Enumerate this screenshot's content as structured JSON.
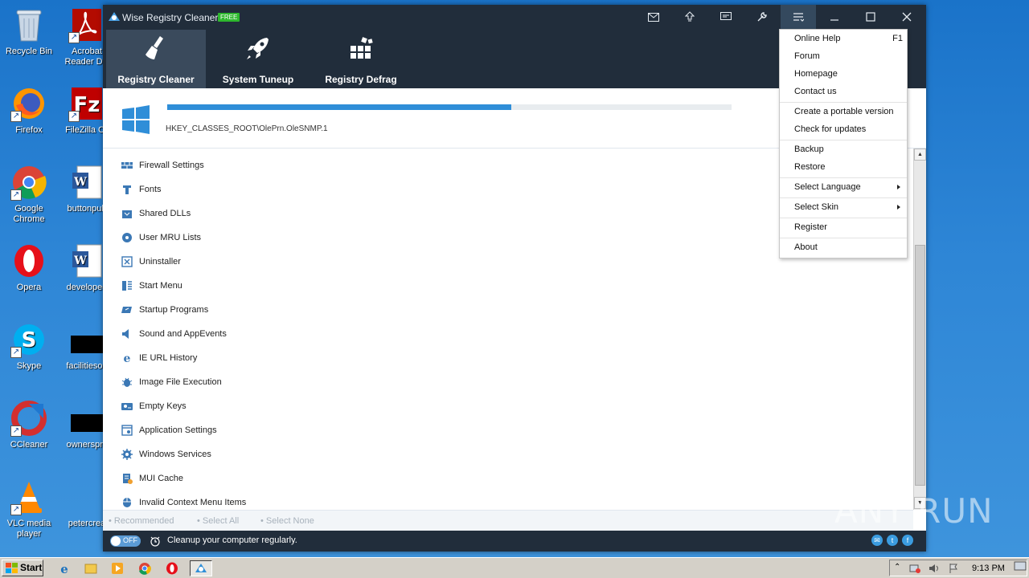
{
  "desktop": {
    "icons": [
      {
        "label": "Recycle Bin"
      },
      {
        "label": "Acrobat Reader DC"
      },
      {
        "label": "Firefox"
      },
      {
        "label": "FileZilla Cli"
      },
      {
        "label": "Google Chrome"
      },
      {
        "label": "buttonpub"
      },
      {
        "label": "Opera"
      },
      {
        "label": "developed"
      },
      {
        "label": "Skype"
      },
      {
        "label": "facilitiesop"
      },
      {
        "label": "CCleaner"
      },
      {
        "label": "ownerspm"
      },
      {
        "label": "VLC media player"
      },
      {
        "label": "petercrea"
      }
    ]
  },
  "window": {
    "title": "Wise Registry Cleaner X",
    "badge": "FREE",
    "titlebar_icons": [
      "mail-icon",
      "upgrade-icon",
      "feedback-icon",
      "tools-icon",
      "menu-icon",
      "minimize-icon",
      "maximize-icon",
      "close-icon"
    ]
  },
  "nav": {
    "tabs": [
      {
        "label": "Registry Cleaner",
        "active": true
      },
      {
        "label": "System Tuneup",
        "active": false
      },
      {
        "label": "Registry Defrag",
        "active": false
      }
    ]
  },
  "scan": {
    "progress": 0.61,
    "current_key": "HKEY_CLASSES_ROOT\\OlePrn.OleSNMP.1"
  },
  "categories": [
    {
      "label": "Firewall Settings",
      "icon": "firewall-icon"
    },
    {
      "label": "Fonts",
      "icon": "font-icon"
    },
    {
      "label": "Shared DLLs",
      "icon": "dll-icon"
    },
    {
      "label": "User MRU Lists",
      "icon": "mru-icon"
    },
    {
      "label": "Uninstaller",
      "icon": "uninstaller-icon"
    },
    {
      "label": "Start Menu",
      "icon": "start-menu-icon"
    },
    {
      "label": "Startup Programs",
      "icon": "startup-icon"
    },
    {
      "label": "Sound and AppEvents",
      "icon": "sound-icon"
    },
    {
      "label": "IE URL History",
      "icon": "ie-icon"
    },
    {
      "label": "Image File Execution",
      "icon": "bug-icon"
    },
    {
      "label": "Empty Keys",
      "icon": "key-icon"
    },
    {
      "label": "Application Settings",
      "icon": "app-settings-icon"
    },
    {
      "label": "Windows Services",
      "icon": "gear-icon"
    },
    {
      "label": "MUI Cache",
      "icon": "cache-icon"
    },
    {
      "label": "Invalid Context Menu Items",
      "icon": "mouse-icon"
    }
  ],
  "select_bar": {
    "recommended": "Recommended",
    "select_all": "Select All",
    "select_none": "Select None"
  },
  "status": {
    "toggle_label": "OFF",
    "message": "Cleanup your computer regularly."
  },
  "menu": {
    "items": [
      {
        "label": "Online Help",
        "shortcut": "F1"
      },
      {
        "label": "Forum"
      },
      {
        "label": "Homepage"
      },
      {
        "label": "Contact us"
      },
      {
        "label": "Create a portable version"
      },
      {
        "label": "Check for updates"
      },
      {
        "label": "Backup"
      },
      {
        "label": "Restore"
      },
      {
        "label": "Select Language",
        "submenu": true
      },
      {
        "label": "Select Skin",
        "submenu": true
      },
      {
        "label": "Register"
      },
      {
        "label": "About"
      }
    ]
  },
  "watermark": "ANY RUN",
  "taskbar": {
    "start_label": "Start",
    "time": "9:13 PM"
  },
  "colors": {
    "dark": "#212d3b",
    "accent": "#2f8ed8",
    "desktop": "#2e86d6"
  }
}
